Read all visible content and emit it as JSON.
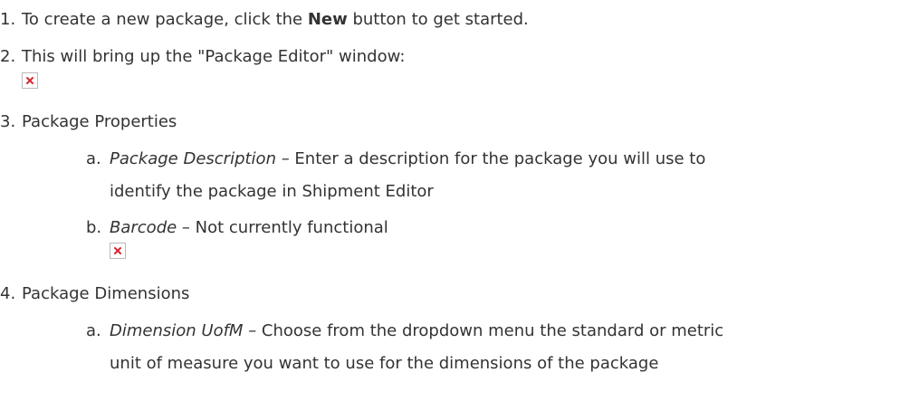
{
  "steps": [
    {
      "number": "1.",
      "text_before": "To create a new package, click the ",
      "bold": "New",
      "text_after": " button to get started."
    },
    {
      "number": "2.",
      "text": "This will bring up the \"Package Editor\" window:",
      "image_icon": "broken-image-icon"
    },
    {
      "number": "3.",
      "text": "Package Properties",
      "substeps": [
        {
          "letter": "a.",
          "term": "Package Description",
          "desc_line1": " – Enter a description for the package you will use to",
          "desc_line2": "identify the package in Shipment Editor"
        },
        {
          "letter": "b.",
          "term": "Barcode",
          "desc_line1": " – Not currently functional",
          "image_icon": "broken-image-icon"
        }
      ]
    },
    {
      "number": "4.",
      "text": "Package Dimensions",
      "substeps": [
        {
          "letter": "a.",
          "term": "Dimension UofM",
          "desc_line1": " – Choose from the dropdown menu the standard or metric",
          "desc_line2": "unit of measure you want to use for the dimensions of the package"
        }
      ]
    }
  ],
  "colors": {
    "text": "#333333",
    "broken_icon_x": "#d9262f"
  }
}
